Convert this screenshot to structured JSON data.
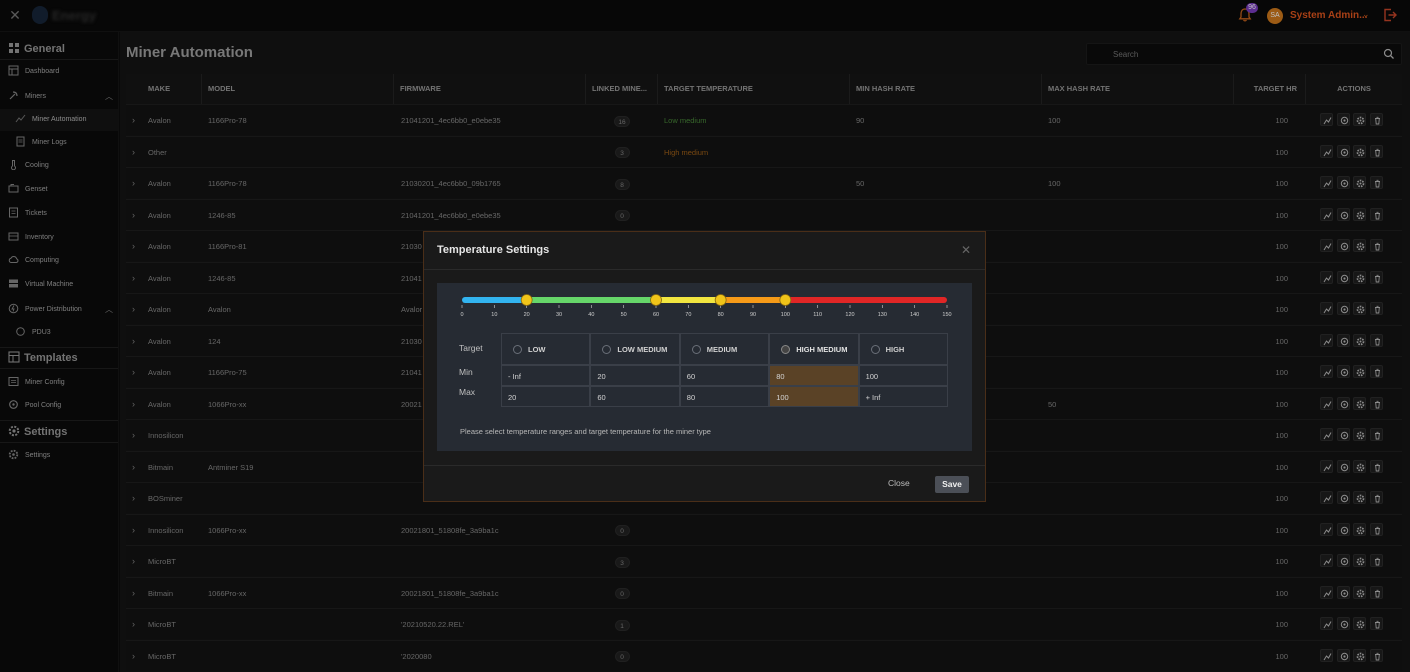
{
  "topbar": {
    "close_glyph": "✕",
    "brand": "Energy",
    "notification_count": "96",
    "user_initials": "SA",
    "user_name": "System Admin...",
    "user_chevron": "⌄"
  },
  "sidebar": {
    "sections": [
      {
        "label": "General",
        "icon": "grid-icon"
      },
      {
        "label": "Templates",
        "icon": "template-icon"
      },
      {
        "label": "Settings",
        "icon": "gear-icon"
      }
    ],
    "items": [
      {
        "label": "Dashboard",
        "icon": "dashboard-icon"
      },
      {
        "label": "Miners",
        "icon": "miner-icon",
        "expanded": true
      },
      {
        "label": "Miner Automation",
        "icon": "automation-icon",
        "active": true
      },
      {
        "label": "Miner Logs",
        "icon": "log-icon"
      },
      {
        "label": "Cooling",
        "icon": "thermometer-icon"
      },
      {
        "label": "Genset",
        "icon": "generator-icon"
      },
      {
        "label": "Tickets",
        "icon": "ticket-icon"
      },
      {
        "label": "Inventory",
        "icon": "inventory-icon"
      },
      {
        "label": "Computing",
        "icon": "cloud-icon"
      },
      {
        "label": "Virtual Machine",
        "icon": "server-icon"
      },
      {
        "label": "Power Distribution",
        "icon": "power-icon",
        "expanded": true
      },
      {
        "label": "PDU3",
        "icon": "pdu-icon"
      },
      {
        "label": "Miner Config",
        "icon": "config-icon"
      },
      {
        "label": "Pool Config",
        "icon": "pool-icon"
      },
      {
        "label": "Settings",
        "icon": "gear-icon"
      }
    ]
  },
  "main": {
    "title": "Miner Automation",
    "search_placeholder": "Search"
  },
  "table": {
    "columns": [
      "MAKE",
      "MODEL",
      "FIRMWARE",
      "LINKED MINE...",
      "TARGET TEMPERATURE",
      "MIN HASH RATE",
      "MAX HASH RATE",
      "TARGET HR",
      "ACTIONS"
    ],
    "rows": [
      {
        "make": "Avalon",
        "model": "1166Pro-78",
        "firmware": "21041201_4ec6bb0_e0ebe35",
        "linked": "16",
        "target_temp": "Low medium",
        "temp_class": "low",
        "min_hr": "90",
        "max_hr": "100",
        "target_hr": "100"
      },
      {
        "make": "Other",
        "model": "",
        "firmware": "",
        "linked": "3",
        "target_temp": "High medium",
        "temp_class": "high",
        "min_hr": "",
        "max_hr": "",
        "target_hr": "100"
      },
      {
        "make": "Avalon",
        "model": "1166Pro-78",
        "firmware": "21030201_4ec6bb0_09b1765",
        "linked": "8",
        "target_temp": "",
        "temp_class": "",
        "min_hr": "50",
        "max_hr": "100",
        "target_hr": "100"
      },
      {
        "make": "Avalon",
        "model": "1246-85",
        "firmware": "21041201_4ec6bb0_e0ebe35",
        "linked": "0",
        "target_temp": "",
        "temp_class": "",
        "min_hr": "",
        "max_hr": "",
        "target_hr": "100"
      },
      {
        "make": "Avalon",
        "model": "1166Pro-81",
        "firmware": "21030",
        "linked": "",
        "target_temp": "",
        "temp_class": "",
        "min_hr": "",
        "max_hr": "",
        "target_hr": "100"
      },
      {
        "make": "Avalon",
        "model": "1246-85",
        "firmware": "21041",
        "linked": "",
        "target_temp": "",
        "temp_class": "",
        "min_hr": "",
        "max_hr": "",
        "target_hr": "100"
      },
      {
        "make": "Avalon",
        "model": "Avalon",
        "firmware": "Avalor",
        "linked": "",
        "target_temp": "",
        "temp_class": "",
        "min_hr": "",
        "max_hr": "",
        "target_hr": "100"
      },
      {
        "make": "Avalon",
        "model": "124",
        "firmware": "21030",
        "linked": "",
        "target_temp": "",
        "temp_class": "",
        "min_hr": "",
        "max_hr": "",
        "target_hr": "100"
      },
      {
        "make": "Avalon",
        "model": "1166Pro-75",
        "firmware": "21041",
        "linked": "",
        "target_temp": "",
        "temp_class": "",
        "min_hr": "",
        "max_hr": "",
        "target_hr": "100"
      },
      {
        "make": "Avalon",
        "model": "1066Pro-xx",
        "firmware": "20021",
        "linked": "",
        "target_temp": "",
        "temp_class": "",
        "min_hr": "",
        "max_hr": "50",
        "target_hr": "100"
      },
      {
        "make": "Innosilicon",
        "model": "",
        "firmware": "",
        "linked": "",
        "target_temp": "",
        "temp_class": "",
        "min_hr": "",
        "max_hr": "",
        "target_hr": "100"
      },
      {
        "make": "Bitmain",
        "model": "Antminer S19",
        "firmware": "",
        "linked": "",
        "target_temp": "",
        "temp_class": "",
        "min_hr": "",
        "max_hr": "",
        "target_hr": "100"
      },
      {
        "make": "BOSminer",
        "model": "",
        "firmware": "",
        "linked": "",
        "target_temp": "",
        "temp_class": "",
        "min_hr": "",
        "max_hr": "",
        "target_hr": "100"
      },
      {
        "make": "Innosilicon",
        "model": "1066Pro-xx",
        "firmware": "20021801_51808fe_3a9ba1c",
        "linked": "0",
        "target_temp": "",
        "temp_class": "",
        "min_hr": "",
        "max_hr": "",
        "target_hr": "100"
      },
      {
        "make": "MicroBT",
        "model": "",
        "firmware": "",
        "linked": "3",
        "target_temp": "",
        "temp_class": "",
        "min_hr": "",
        "max_hr": "",
        "target_hr": "100"
      },
      {
        "make": "Bitmain",
        "model": "1066Pro-xx",
        "firmware": "20021801_51808fe_3a9ba1c",
        "linked": "0",
        "target_temp": "",
        "temp_class": "",
        "min_hr": "",
        "max_hr": "",
        "target_hr": "100"
      },
      {
        "make": "MicroBT",
        "model": "",
        "firmware": "'20210520.22.REL'",
        "linked": "1",
        "target_temp": "",
        "temp_class": "",
        "min_hr": "",
        "max_hr": "",
        "target_hr": "100"
      },
      {
        "make": "MicroBT",
        "model": "",
        "firmware": "'2020080",
        "linked": "0",
        "target_temp": "",
        "temp_class": "",
        "min_hr": "",
        "max_hr": "",
        "target_hr": "100"
      }
    ],
    "action_icons": [
      "chart-icon",
      "target-icon",
      "gear-icon",
      "trash-icon"
    ]
  },
  "modal": {
    "title": "Temperature Settings",
    "close_glyph": "✕",
    "slider": {
      "min": 0,
      "max": 150,
      "ticks": [
        "0",
        "10",
        "20",
        "30",
        "40",
        "50",
        "60",
        "70",
        "80",
        "90",
        "100",
        "110",
        "120",
        "130",
        "140",
        "150"
      ],
      "handles": [
        20,
        60,
        80,
        100
      ],
      "colors": [
        "#32b4f0",
        "#66d66a",
        "#f2e640",
        "#f59a18",
        "#e02626"
      ]
    },
    "row_labels": {
      "target": "Target",
      "min": "Min",
      "max": "Max"
    },
    "levels": [
      {
        "label": "LOW",
        "min": "- Inf",
        "max": "20",
        "selected": false
      },
      {
        "label": "LOW MEDIUM",
        "min": "20",
        "max": "60",
        "selected": false
      },
      {
        "label": "MEDIUM",
        "min": "60",
        "max": "80",
        "selected": false
      },
      {
        "label": "HIGH MEDIUM",
        "min": "80",
        "max": "100",
        "selected": true
      },
      {
        "label": "HIGH",
        "min": "100",
        "max": "+ Inf",
        "selected": false
      }
    ],
    "hint": "Please select temperature ranges and target temperature for the miner type",
    "close_label": "Close",
    "save_label": "Save"
  }
}
